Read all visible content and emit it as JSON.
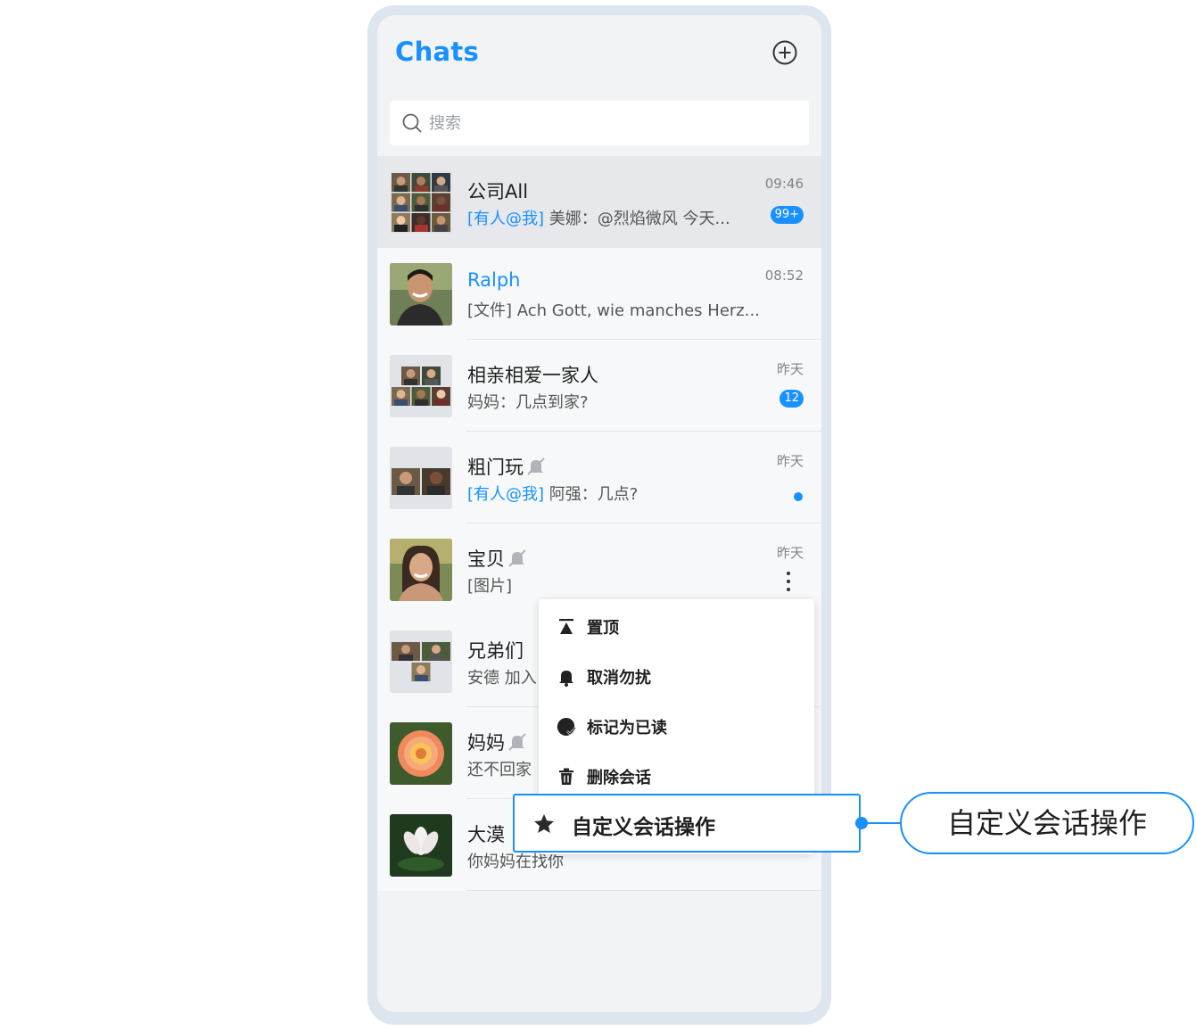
{
  "header": {
    "title": "Chats",
    "add_icon": "plus-circle-icon"
  },
  "search": {
    "placeholder": "搜索",
    "icon": "search-icon"
  },
  "chats": [
    {
      "name": "公司All",
      "mention": "[有人@我]",
      "preview": "美娜：@烈焰微风 今天...",
      "time": "09:46",
      "badge": "99+",
      "muted": false,
      "pinned": true
    },
    {
      "name": "Ralph",
      "mention": "",
      "preview": "[文件] Ach Gott, wie manches Herz...",
      "time": "08:52",
      "badge": "",
      "muted": false,
      "pinned": false
    },
    {
      "name": "相亲相爱一家人",
      "mention": "",
      "preview": "妈妈：几点到家?",
      "time": "昨天",
      "badge": "12",
      "muted": false,
      "pinned": false
    },
    {
      "name": "粗门玩",
      "mention": "[有人@我]",
      "preview": "阿强：几点?",
      "time": "昨天",
      "badge": "",
      "muted": true,
      "unread_dot": true,
      "pinned": false
    },
    {
      "name": "宝贝",
      "mention": "",
      "preview": "[图片]",
      "time": "昨天",
      "badge": "",
      "muted": true,
      "pinned": false
    },
    {
      "name": "兄弟们",
      "mention": "",
      "preview": "安德 加入",
      "time": "",
      "badge": "",
      "muted": false,
      "pinned": false
    },
    {
      "name": "妈妈",
      "mention": "",
      "preview": "还不回家",
      "time": "",
      "badge": "",
      "muted": true,
      "pinned": false
    },
    {
      "name": "大漠",
      "mention": "",
      "preview": "你妈妈在找你",
      "time": "",
      "badge": "",
      "muted": false,
      "pinned": false
    }
  ],
  "context_menu": {
    "items": [
      {
        "label": "置顶",
        "icon": "pin-top-icon"
      },
      {
        "label": "取消勿扰",
        "icon": "bell-icon"
      },
      {
        "label": "标记为已读",
        "icon": "mark-read-icon"
      },
      {
        "label": "删除会话",
        "icon": "trash-icon"
      }
    ],
    "custom": {
      "label": "自定义会话操作",
      "icon": "star-icon"
    }
  },
  "callout": {
    "label": "自定义会话操作"
  },
  "colors": {
    "accent": "#1890ff",
    "frame": "#dde5ee",
    "screen_bg": "#f2f3f5"
  }
}
